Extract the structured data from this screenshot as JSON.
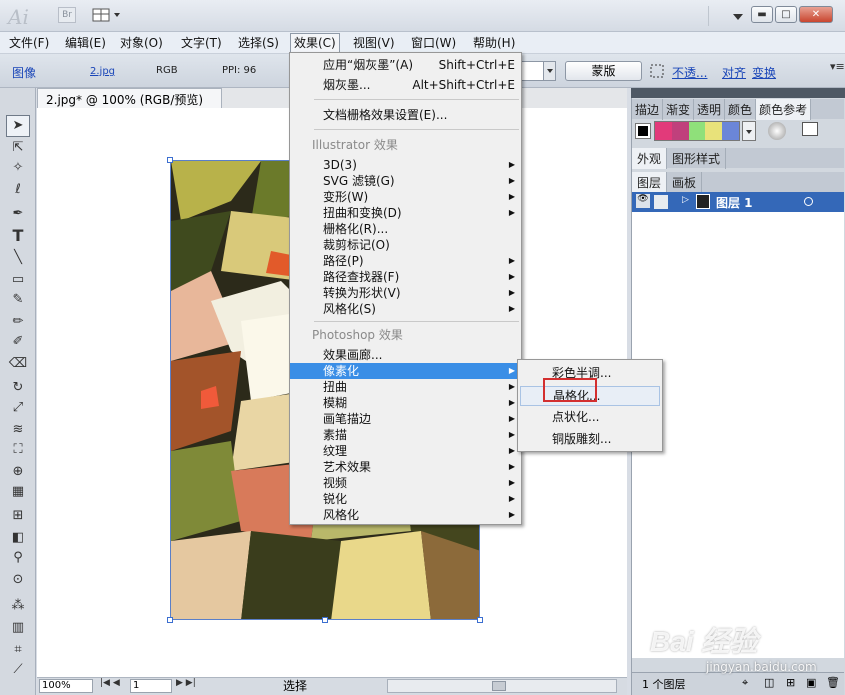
{
  "titlebar": {
    "app_logo": "Ai",
    "bridge_label": "Br",
    "window_buttons": {
      "minimize": "▬",
      "restore": "□",
      "close": "✕"
    }
  },
  "menubar": {
    "items": [
      "文件(F)",
      "编辑(E)",
      "对象(O)",
      "文字(T)",
      "选择(S)",
      "效果(C)",
      "视图(V)",
      "窗口(W)",
      "帮助(H)"
    ]
  },
  "controlbar": {
    "image_label": "图像",
    "file_link": "2.jpg",
    "color_mode": "RGB",
    "ppi": "PPI: 96",
    "mask_button": "蒙版",
    "opacity_link": "不透...",
    "align_link": "对齐",
    "transform_link": "变换"
  },
  "document": {
    "tab_title": "2.jpg* @ 100% (RGB/预览)",
    "close_icon": "⊠"
  },
  "statusbar": {
    "zoom": "100%",
    "page": "1",
    "tool_label": "选择"
  },
  "effects_menu": {
    "apply_last": {
      "label": "应用“烟灰墨”(A)",
      "shortcut": "Shift+Ctrl+E"
    },
    "last_effect": {
      "label": "烟灰墨...",
      "shortcut": "Alt+Shift+Ctrl+E"
    },
    "raster_settings": "文档栅格效果设置(E)...",
    "illustrator_header": "Illustrator 效果",
    "illustrator_items": [
      {
        "label": "3D(3)",
        "submenu": true
      },
      {
        "label": "SVG 滤镜(G)",
        "submenu": true
      },
      {
        "label": "变形(W)",
        "submenu": true
      },
      {
        "label": "扭曲和变换(D)",
        "submenu": true
      },
      {
        "label": "栅格化(R)...",
        "submenu": false
      },
      {
        "label": "裁剪标记(O)",
        "submenu": false
      },
      {
        "label": "路径(P)",
        "submenu": true
      },
      {
        "label": "路径查找器(F)",
        "submenu": true
      },
      {
        "label": "转换为形状(V)",
        "submenu": true
      },
      {
        "label": "风格化(S)",
        "submenu": true
      }
    ],
    "photoshop_header": "Photoshop 效果",
    "photoshop_items": [
      {
        "label": "效果画廊...",
        "submenu": false,
        "highlighted": false
      },
      {
        "label": "像素化",
        "submenu": true,
        "highlighted": true
      },
      {
        "label": "扭曲",
        "submenu": true,
        "highlighted": false
      },
      {
        "label": "模糊",
        "submenu": true,
        "highlighted": false
      },
      {
        "label": "画笔描边",
        "submenu": true,
        "highlighted": false
      },
      {
        "label": "素描",
        "submenu": true,
        "highlighted": false
      },
      {
        "label": "纹理",
        "submenu": true,
        "highlighted": false
      },
      {
        "label": "艺术效果",
        "submenu": true,
        "highlighted": false
      },
      {
        "label": "视频",
        "submenu": true,
        "highlighted": false
      },
      {
        "label": "锐化",
        "submenu": true,
        "highlighted": false
      },
      {
        "label": "风格化",
        "submenu": true,
        "highlighted": false
      }
    ]
  },
  "pixelate_submenu": {
    "items": [
      {
        "label": "彩色半调...",
        "hovered": false
      },
      {
        "label": "晶格化...",
        "hovered": true
      },
      {
        "label": "点状化...",
        "hovered": false
      },
      {
        "label": "铜版雕刻...",
        "hovered": false
      }
    ]
  },
  "right_panel": {
    "top_tabs": [
      "描边",
      "渐变",
      "透明",
      "颜色",
      "颜色参考"
    ],
    "appearance_tabs": [
      "外观",
      "图形样式"
    ],
    "layer_tabs": [
      "图层",
      "画板"
    ],
    "layer_name": "图层 1",
    "layer_count": "1 个图层",
    "swatch_colors": [
      "#e23a7a",
      "#c0407c",
      "#8fe07a",
      "#e8e27a",
      "#6b86d8"
    ]
  },
  "watermark": {
    "logo": "Bai 经验",
    "url": "jingyan.baidu.com"
  },
  "colors": {
    "menu_highlight": "#3a8ee6",
    "annotation_red": "#d32f2f",
    "link_blue": "#1a46b8"
  }
}
